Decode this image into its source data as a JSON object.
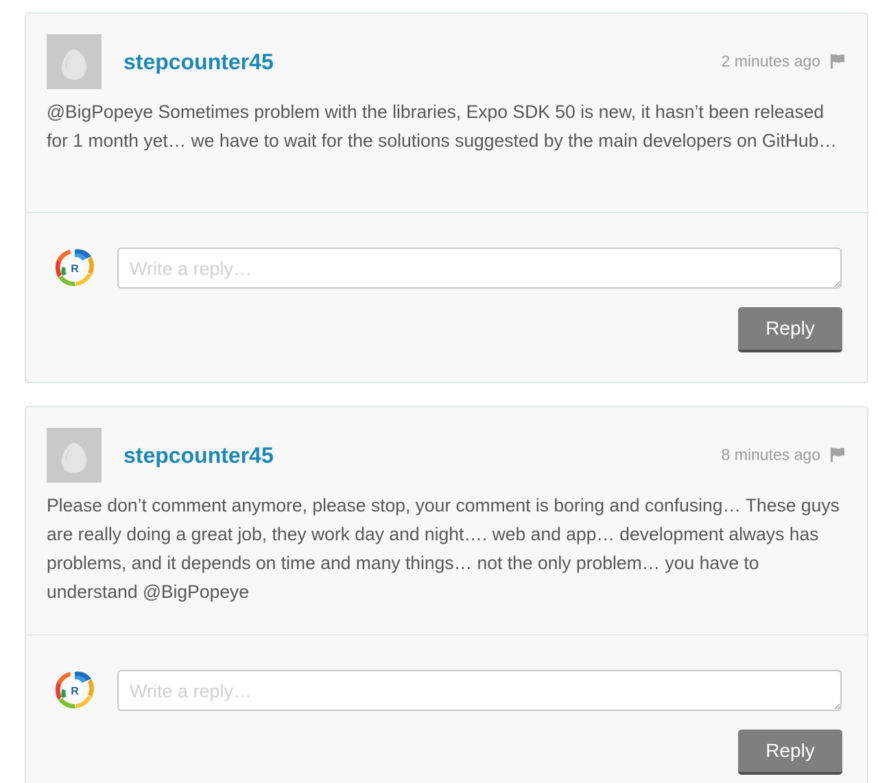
{
  "comments": [
    {
      "author": "stepcounter45",
      "timestamp": "2 minutes ago",
      "text": "@BigPopeye Sometimes problem with the libraries, Expo SDK 50 is new, it hasn’t been released for 1 month yet… we have to wait for the solutions suggested by the main developers on GitHub…",
      "reply_placeholder": "Write a reply…",
      "reply_button_label": "Reply"
    },
    {
      "author": "stepcounter45",
      "timestamp": "8 minutes ago",
      "text": "Please don’t comment anymore, please stop, your comment is boring and confusing… These guys are really doing a great job, they work day and night…. web and app… development always has problems, and it depends on time and many things… not the only problem… you have to understand @BigPopeye",
      "reply_placeholder": "Write a reply…",
      "reply_button_label": "Reply"
    }
  ],
  "icons": {
    "author_avatar": "default-avatar-icon",
    "flag": "flag-icon",
    "reply_avatar": "user-logo-avatar-icon",
    "resize": "resize-grip-icon"
  },
  "colors": {
    "author_link": "#1e88b5",
    "card_background": "#f8f8f8",
    "card_border": "#dfe6e6",
    "reply_button": "#7f7f7f"
  }
}
